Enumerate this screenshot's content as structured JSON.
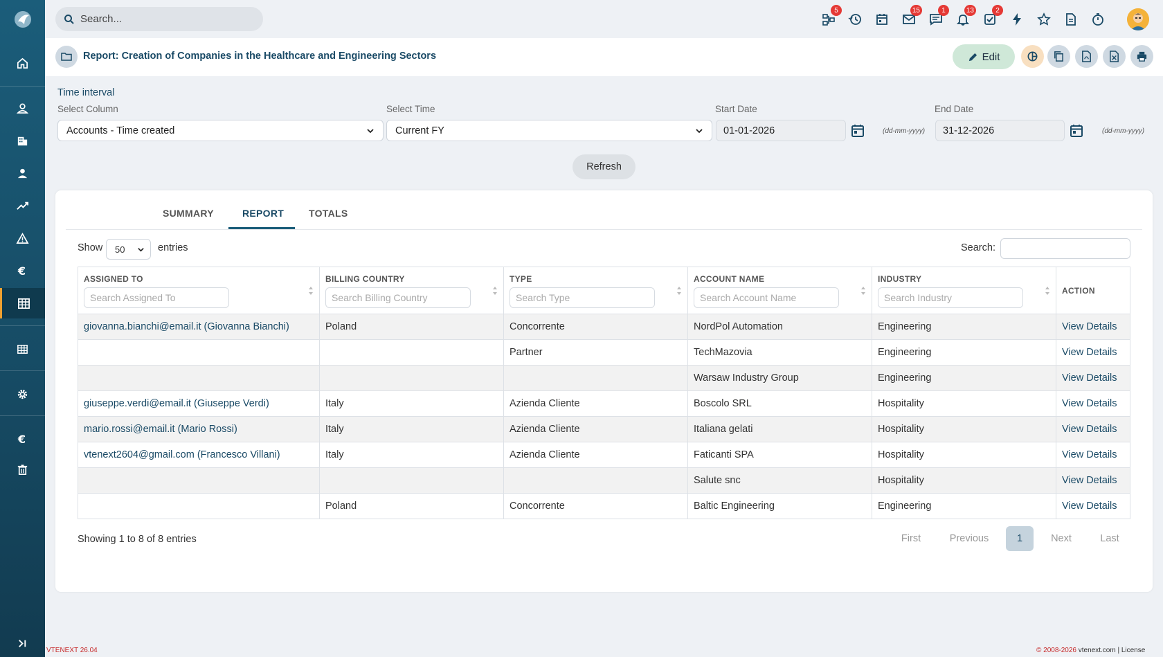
{
  "sidebar": {
    "items": [
      "logo-icon",
      "home-icon",
      "user-outline-icon",
      "building-icon",
      "contact-icon",
      "trend-icon",
      "warning-icon",
      "euro-icon",
      "table-icon",
      "grid-icon",
      "gear-icon",
      "euro-icon",
      "trash-icon",
      "expand-icon"
    ]
  },
  "topbar": {
    "search_placeholder": "Search...",
    "badges": {
      "network": "5",
      "mail": "15",
      "chat": "1",
      "bell": "13",
      "tasks": "2"
    }
  },
  "titlebar": {
    "title": "Report: Creation of Companies in the Healthcare and Engineering Sectors",
    "edit_label": "Edit"
  },
  "filters": {
    "time_interval_label": "Time interval",
    "select_column_label": "Select Column",
    "select_column_value": "Accounts - Time created",
    "select_time_label": "Select Time",
    "select_time_value": "Current FY",
    "start_date_label": "Start Date",
    "start_date_value": "01-01-2026",
    "end_date_label": "End Date",
    "end_date_value": "31-12-2026",
    "date_format": "(dd-mm-yyyy)",
    "refresh_label": "Refresh"
  },
  "tabs": [
    "SUMMARY",
    "REPORT",
    "TOTALS"
  ],
  "table_controls": {
    "show_label": "Show",
    "entries_value": "50",
    "entries_label": "entries",
    "search_label": "Search:"
  },
  "table": {
    "headers": [
      {
        "label": "ASSIGNED TO",
        "placeholder": "Search Assigned To"
      },
      {
        "label": "BILLING COUNTRY",
        "placeholder": "Search Billing Country"
      },
      {
        "label": "TYPE",
        "placeholder": "Search Type"
      },
      {
        "label": "ACCOUNT NAME",
        "placeholder": "Search Account Name"
      },
      {
        "label": "INDUSTRY",
        "placeholder": "Search Industry"
      },
      {
        "label": "ACTION"
      }
    ],
    "rows": [
      [
        "giovanna.bianchi@email.it (Giovanna Bianchi)",
        "Poland",
        "Concorrente",
        "NordPol Automation",
        "Engineering",
        "View Details"
      ],
      [
        "",
        "",
        "Partner",
        "TechMazovia",
        "Engineering",
        "View Details"
      ],
      [
        "",
        "",
        "",
        "Warsaw Industry Group",
        "Engineering",
        "View Details"
      ],
      [
        "giuseppe.verdi@email.it (Giuseppe Verdi)",
        "Italy",
        "Azienda Cliente",
        "Boscolo SRL",
        "Hospitality",
        "View Details"
      ],
      [
        "mario.rossi@email.it (Mario Rossi)",
        "Italy",
        "Azienda Cliente",
        "Italiana gelati",
        "Hospitality",
        "View Details"
      ],
      [
        "vtenext2604@gmail.com (Francesco Villani)",
        "Italy",
        "Azienda Cliente",
        "Faticanti SPA",
        "Hospitality",
        "View Details"
      ],
      [
        "",
        "",
        "",
        "Salute snc",
        "Hospitality",
        "View Details"
      ],
      [
        "",
        "Poland",
        "Concorrente",
        "Baltic Engineering",
        "Engineering",
        "View Details"
      ]
    ]
  },
  "pagination": {
    "showing": "Showing 1 to 8 of 8 entries",
    "first": "First",
    "previous": "Previous",
    "current": "1",
    "next": "Next",
    "last": "Last"
  },
  "footer": {
    "version": "VTENEXT 26.04",
    "copyright": "© 2008-2026",
    "site": "vtenext.com",
    "license": "License"
  }
}
